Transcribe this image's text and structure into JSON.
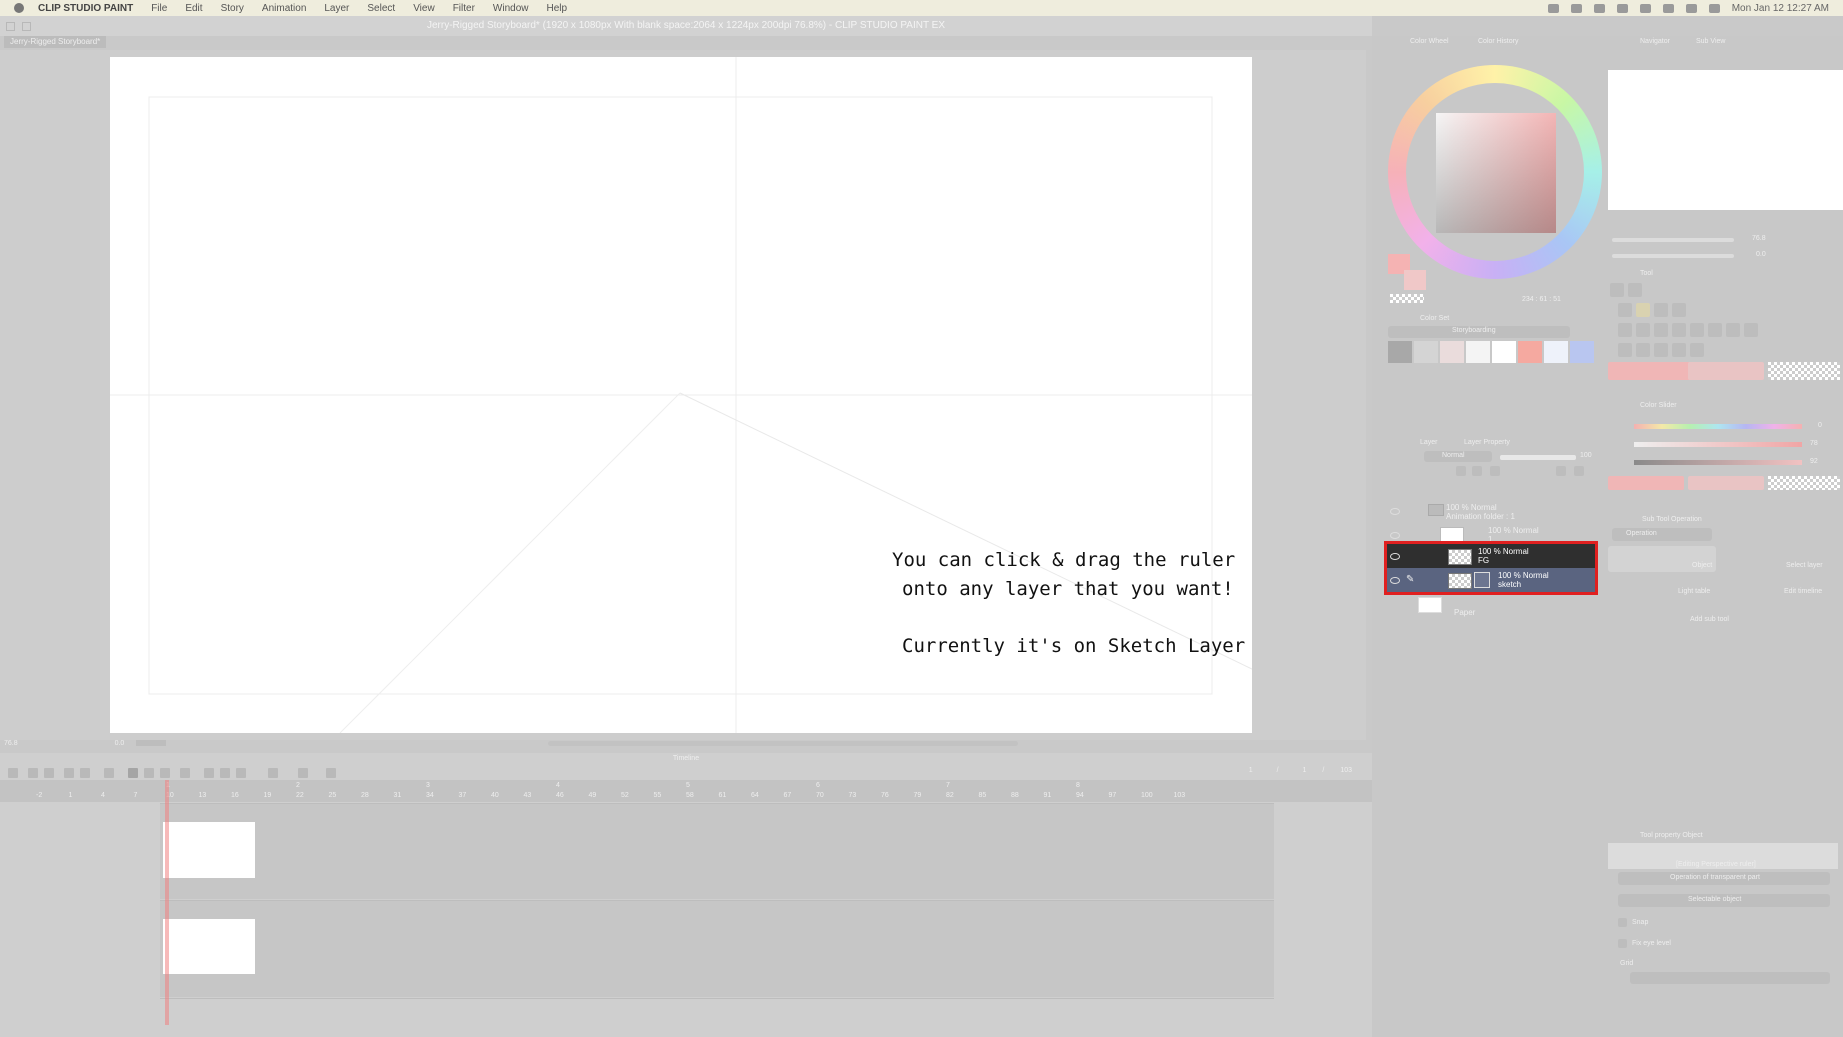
{
  "menubar": {
    "app_name": "CLIP STUDIO PAINT",
    "menus": [
      "File",
      "Edit",
      "Story",
      "Animation",
      "Layer",
      "Select",
      "View",
      "Filter",
      "Window",
      "Help"
    ],
    "clock": "Mon Jan 12  12:27 AM"
  },
  "window": {
    "title": "Jerry-Rigged Storyboard* (1920 x 1080px With blank space:2064 x 1224px 200dpi 76.8%)  - CLIP STUDIO PAINT EX",
    "doc_tab": "Jerry-Rigged Storyboard*"
  },
  "canvas": {
    "note_line1": "You can click & drag the ruler",
    "note_line2": "onto any layer that you want!",
    "note_line3": "Currently it's on Sketch Layer",
    "zoom": "76.8",
    "rotation": "0.0"
  },
  "timeline": {
    "title": "Timeline",
    "frame_counter": [
      "1",
      "/",
      "1",
      "/",
      "103"
    ],
    "ruler_numbers": [
      "-2",
      "1",
      "4",
      "7",
      "10",
      "13",
      "16",
      "19",
      "22",
      "25",
      "28",
      "31",
      "34",
      "37",
      "40",
      "43",
      "46",
      "49",
      "52",
      "55",
      "58",
      "61",
      "64",
      "67",
      "70",
      "73",
      "76",
      "79",
      "82",
      "85",
      "88",
      "91",
      "94",
      "97",
      "100",
      "103"
    ],
    "section_marks": [
      "1",
      "2",
      "3",
      "4",
      "5",
      "6",
      "7",
      "8"
    ]
  },
  "color_wheel": {
    "panel_title": "Color Wheel",
    "tab2": "Color History",
    "values": "234 : 61 : 51",
    "main_color": "#f5b3b3",
    "sub_color": "#f0c8c8"
  },
  "color_set": {
    "panel_title": "Color Set",
    "set_name": "Storyboarding",
    "swatches": [
      "#a8a8a8",
      "#d4d4d4",
      "#eadcdc",
      "#f4f4f4",
      "#ffffff",
      "#f5a9a0",
      "#eef2fa",
      "#b9c6f0"
    ]
  },
  "navigator": {
    "panel_title": "Navigator",
    "tab2": "Sub View",
    "zoom_value": "76.8",
    "rotate_value": "0.0"
  },
  "tool": {
    "panel_title": "Tool"
  },
  "color_slider": {
    "panel_title": "Color Slider",
    "h_value": "0",
    "s_value": "78",
    "v_value": "92"
  },
  "layer_panel": {
    "panel_title": "Layer",
    "tab2": "Layer Property",
    "blend_mode": "Normal",
    "opacity": "100",
    "layers": [
      {
        "line1": "100 % Normal",
        "line2": "Animation folder : 1"
      },
      {
        "line1": "100 % Normal",
        "line2": "1"
      },
      {
        "line1": "100 % Normal",
        "line2": "FG"
      },
      {
        "line1": "100 % Normal",
        "line2": "sketch"
      },
      {
        "line1": "",
        "line2": "Paper"
      }
    ]
  },
  "sub_tool": {
    "panel_title": "Sub Tool Operation",
    "group": "Operation",
    "items": [
      "Object",
      "Select layer",
      "Light table",
      "Edit timeline"
    ],
    "add_button": "Add sub tool"
  },
  "tool_property": {
    "panel_title": "Tool property Object",
    "editing_label": "[Editing Perspective ruler]",
    "dropdown1": "Operation of transparent part",
    "dropdown2": "Selectable object",
    "snap_label": "Snap",
    "fix_eye_label": "Fix eye level",
    "grid_label": "Grid"
  }
}
